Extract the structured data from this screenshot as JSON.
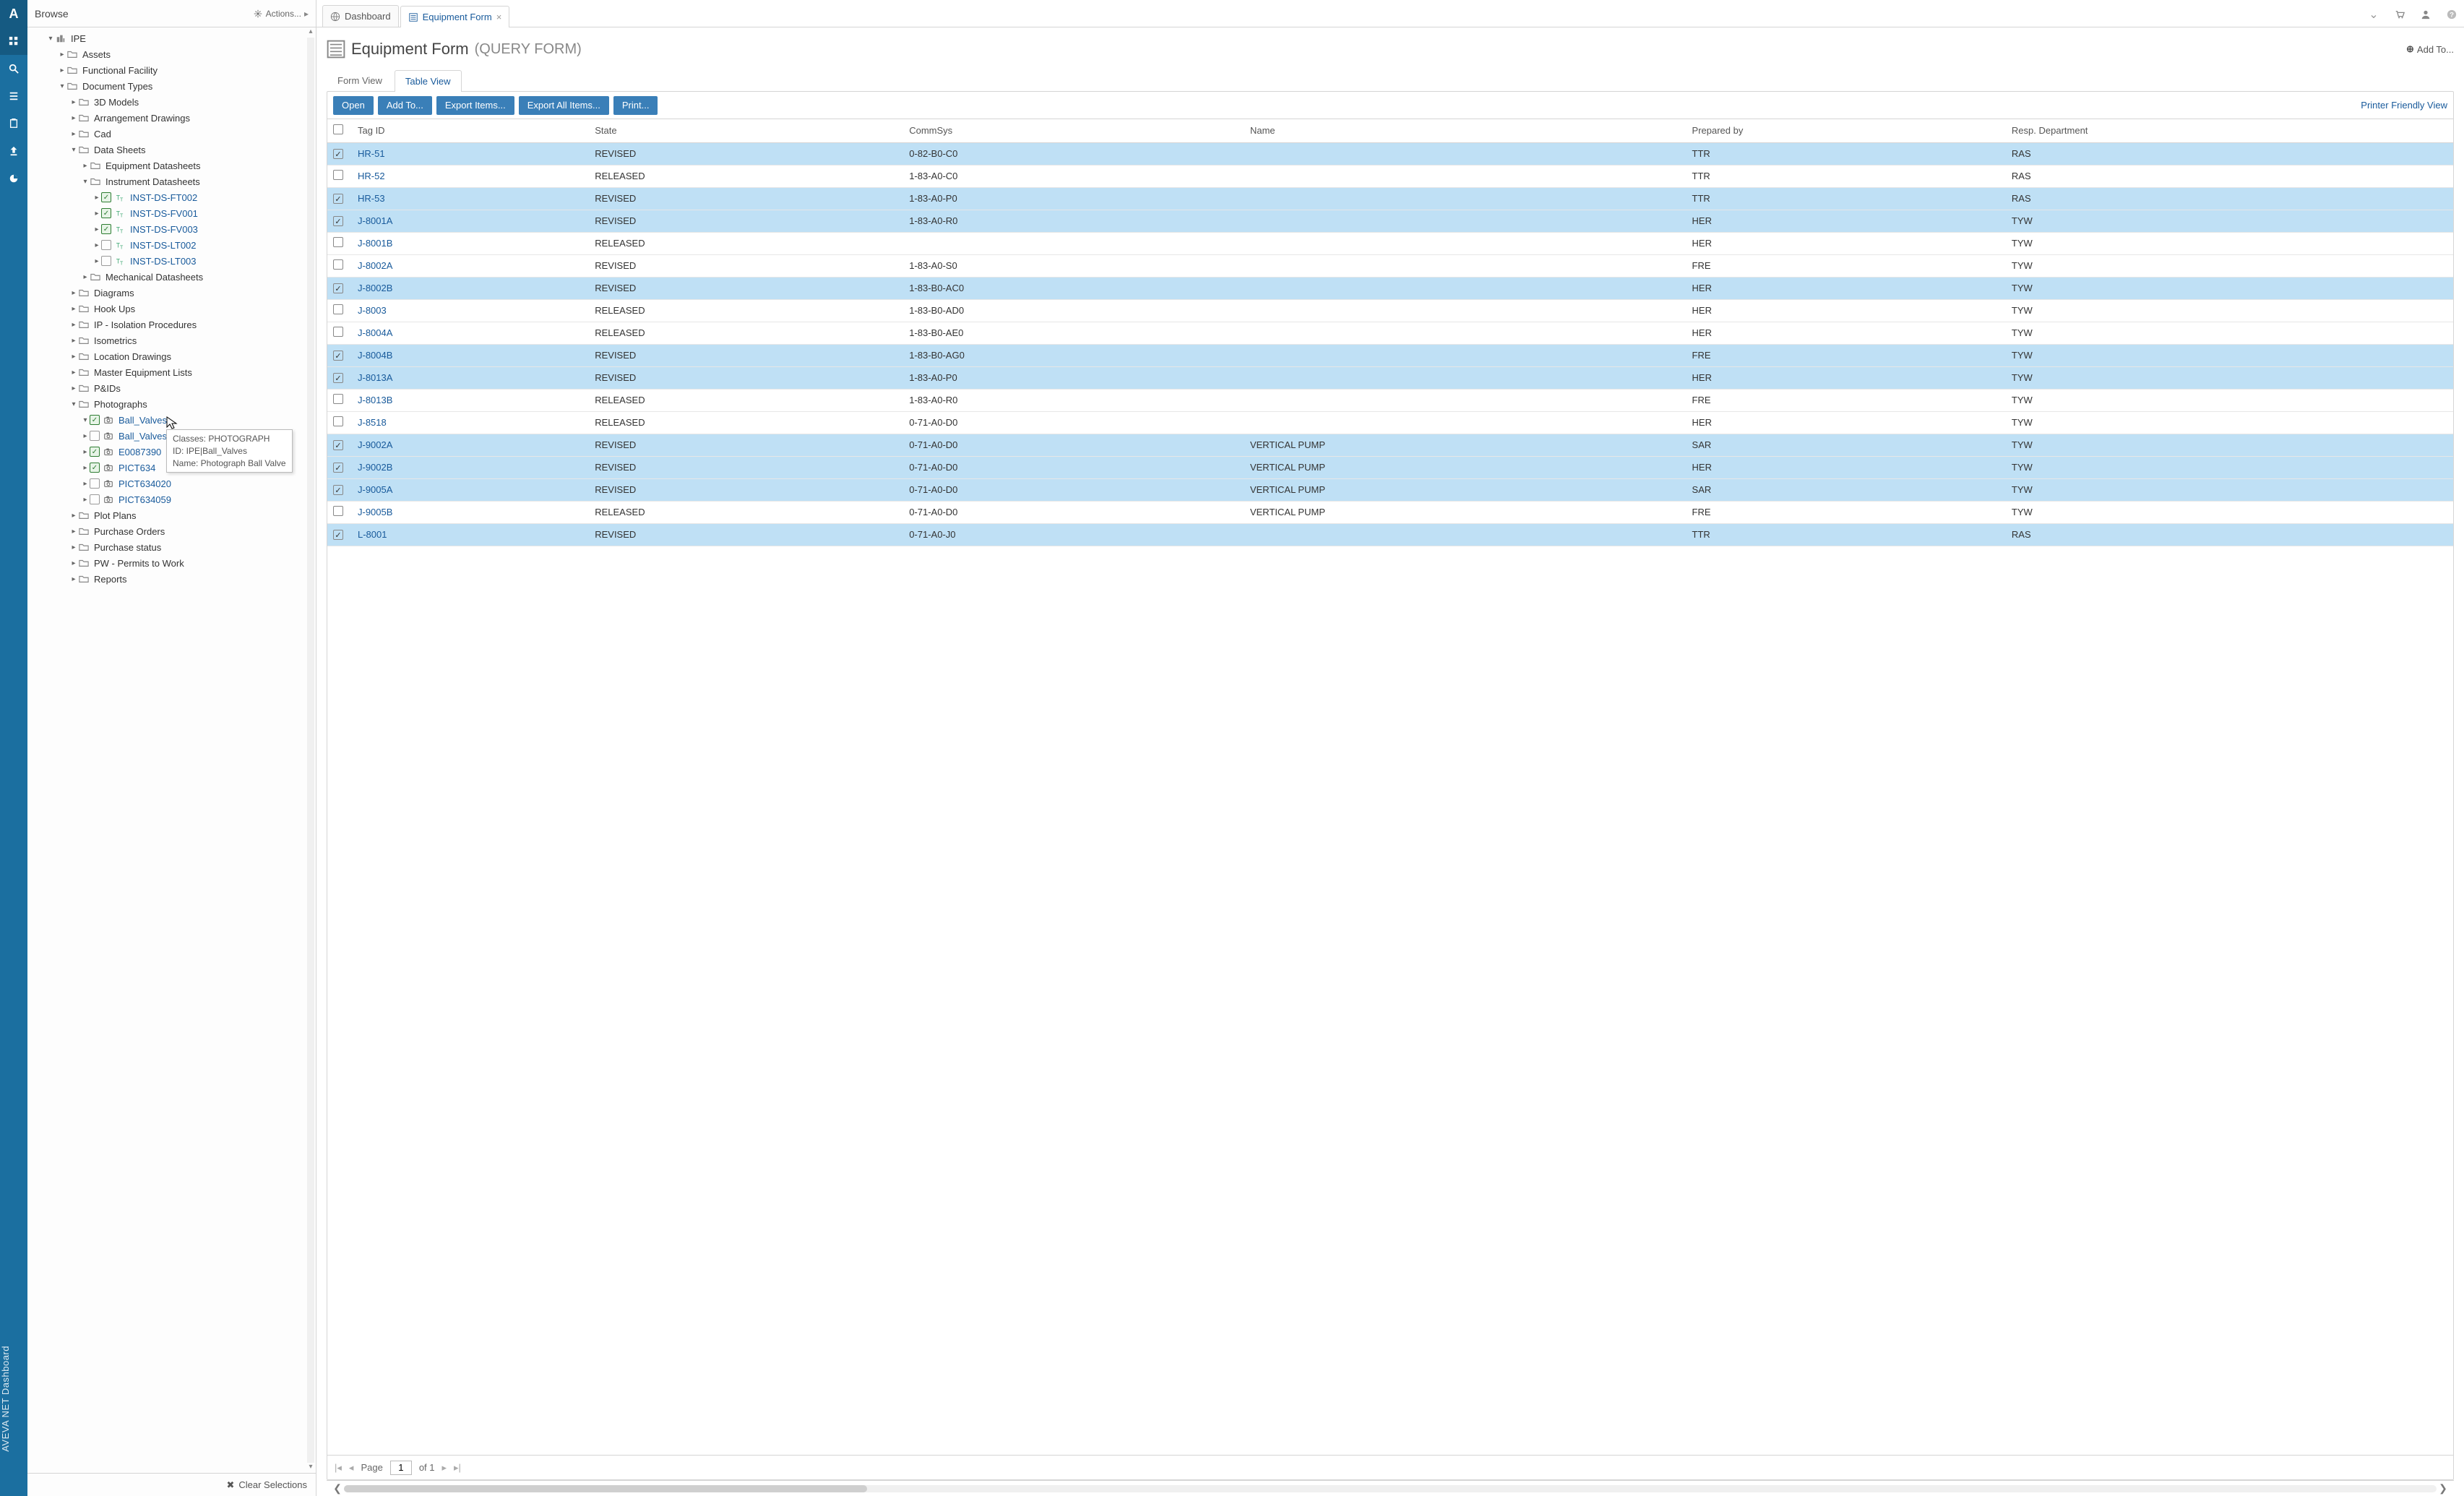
{
  "rail_brand": "AVEVA NET Dashboard",
  "browse": {
    "title": "Browse",
    "actions_label": "Actions...",
    "clear_label": "Clear Selections",
    "root_label": "IPE",
    "tooltip": {
      "l1": "Classes: PHOTOGRAPH",
      "l2": "ID: IPE|Ball_Valves",
      "l3": "Name: Photograph Ball Valve"
    },
    "nodes": [
      {
        "d": 1,
        "tw": "▾",
        "ico": "site",
        "label": "IPE"
      },
      {
        "d": 2,
        "tw": "▸",
        "ico": "fld",
        "label": "Assets"
      },
      {
        "d": 2,
        "tw": "▸",
        "ico": "fld",
        "label": "Functional Facility"
      },
      {
        "d": 2,
        "tw": "▾",
        "ico": "fld",
        "label": "Document Types"
      },
      {
        "d": 3,
        "tw": "▸",
        "ico": "fld",
        "label": "3D Models"
      },
      {
        "d": 3,
        "tw": "▸",
        "ico": "fld",
        "label": "Arrangement Drawings"
      },
      {
        "d": 3,
        "tw": "▸",
        "ico": "fld",
        "label": "Cad"
      },
      {
        "d": 3,
        "tw": "▾",
        "ico": "fld",
        "label": "Data Sheets"
      },
      {
        "d": 4,
        "tw": "▸",
        "ico": "fld",
        "label": "Equipment Datasheets"
      },
      {
        "d": 4,
        "tw": "▾",
        "ico": "fld",
        "label": "Instrument Datasheets"
      },
      {
        "d": 5,
        "tw": "▸",
        "chk": true,
        "ico": "tt",
        "label": "INST-DS-FT002",
        "link": true
      },
      {
        "d": 5,
        "tw": "▸",
        "chk": true,
        "ico": "tt",
        "label": "INST-DS-FV001",
        "link": true
      },
      {
        "d": 5,
        "tw": "▸",
        "chk": true,
        "ico": "tt",
        "label": "INST-DS-FV003",
        "link": true
      },
      {
        "d": 5,
        "tw": "▸",
        "chk": false,
        "ico": "tt",
        "label": "INST-DS-LT002",
        "link": true
      },
      {
        "d": 5,
        "tw": "▸",
        "chk": false,
        "ico": "tt",
        "label": "INST-DS-LT003",
        "link": true
      },
      {
        "d": 4,
        "tw": "▸",
        "ico": "fld",
        "label": "Mechanical Datasheets"
      },
      {
        "d": 3,
        "tw": "▸",
        "ico": "fld",
        "label": "Diagrams"
      },
      {
        "d": 3,
        "tw": "▸",
        "ico": "fld",
        "label": "Hook Ups"
      },
      {
        "d": 3,
        "tw": "▸",
        "ico": "fld",
        "label": "IP - Isolation Procedures"
      },
      {
        "d": 3,
        "tw": "▸",
        "ico": "fld",
        "label": "Isometrics"
      },
      {
        "d": 3,
        "tw": "▸",
        "ico": "fld",
        "label": "Location Drawings"
      },
      {
        "d": 3,
        "tw": "▸",
        "ico": "fld",
        "label": "Master Equipment Lists"
      },
      {
        "d": 3,
        "tw": "▸",
        "ico": "fld",
        "label": "P&IDs"
      },
      {
        "d": 3,
        "tw": "▾",
        "ico": "fld",
        "label": "Photographs"
      },
      {
        "d": 4,
        "tw": "▾",
        "chk": true,
        "ico": "cam",
        "label": "Ball_Valves",
        "link": true,
        "hot": true
      },
      {
        "d": 4,
        "tw": "▸",
        "chk": false,
        "ico": "cam",
        "label": "Ball_Valves",
        "link": true
      },
      {
        "d": 4,
        "tw": "▸",
        "chk": true,
        "ico": "cam",
        "label": "E0087390",
        "link": true
      },
      {
        "d": 4,
        "tw": "▸",
        "chk": true,
        "ico": "cam",
        "label": "PICT634",
        "link": true
      },
      {
        "d": 4,
        "tw": "▸",
        "chk": false,
        "ico": "cam",
        "label": "PICT634020",
        "link": true
      },
      {
        "d": 4,
        "tw": "▸",
        "chk": false,
        "ico": "cam",
        "label": "PICT634059",
        "link": true
      },
      {
        "d": 3,
        "tw": "▸",
        "ico": "fld",
        "label": "Plot Plans"
      },
      {
        "d": 3,
        "tw": "▸",
        "ico": "fld",
        "label": "Purchase Orders"
      },
      {
        "d": 3,
        "tw": "▸",
        "ico": "fld",
        "label": "Purchase status"
      },
      {
        "d": 3,
        "tw": "▸",
        "ico": "fld",
        "label": "PW - Permits to Work"
      },
      {
        "d": 3,
        "tw": "▸",
        "ico": "fld",
        "label": "Reports"
      }
    ]
  },
  "tabs": {
    "dashboard": "Dashboard",
    "equipment": "Equipment Form"
  },
  "page": {
    "title": "Equipment Form",
    "subtitle": "(QUERY FORM)",
    "add_to": "Add To..."
  },
  "viewtabs": {
    "form": "Form View",
    "table": "Table View"
  },
  "toolbar": {
    "open": "Open",
    "addto": "Add To...",
    "export": "Export Items...",
    "exportall": "Export All Items...",
    "print": "Print...",
    "pfv": "Printer Friendly View"
  },
  "grid": {
    "headers": [
      "Tag ID",
      "State",
      "CommSys",
      "Name",
      "Prepared by",
      "Resp. Department"
    ],
    "rows": [
      {
        "sel": true,
        "id": "HR-51",
        "state": "REVISED",
        "comm": "0-82-B0-C0",
        "name": "",
        "prep": "TTR",
        "dept": "RAS"
      },
      {
        "sel": false,
        "id": "HR-52",
        "state": "RELEASED",
        "comm": "1-83-A0-C0",
        "name": "",
        "prep": "TTR",
        "dept": "RAS"
      },
      {
        "sel": true,
        "id": "HR-53",
        "state": "REVISED",
        "comm": "1-83-A0-P0",
        "name": "",
        "prep": "TTR",
        "dept": "RAS"
      },
      {
        "sel": true,
        "id": "J-8001A",
        "state": "REVISED",
        "comm": "1-83-A0-R0",
        "name": "",
        "prep": "HER",
        "dept": "TYW"
      },
      {
        "sel": false,
        "id": "J-8001B",
        "state": "RELEASED",
        "comm": "",
        "name": "",
        "prep": "HER",
        "dept": "TYW"
      },
      {
        "sel": false,
        "id": "J-8002A",
        "state": "REVISED",
        "comm": "1-83-A0-S0",
        "name": "",
        "prep": "FRE",
        "dept": "TYW"
      },
      {
        "sel": true,
        "id": "J-8002B",
        "state": "REVISED",
        "comm": "1-83-B0-AC0",
        "name": "",
        "prep": "HER",
        "dept": "TYW"
      },
      {
        "sel": false,
        "id": "J-8003",
        "state": "RELEASED",
        "comm": "1-83-B0-AD0",
        "name": "",
        "prep": "HER",
        "dept": "TYW"
      },
      {
        "sel": false,
        "id": "J-8004A",
        "state": "RELEASED",
        "comm": "1-83-B0-AE0",
        "name": "",
        "prep": "HER",
        "dept": "TYW"
      },
      {
        "sel": true,
        "id": "J-8004B",
        "state": "REVISED",
        "comm": "1-83-B0-AG0",
        "name": "",
        "prep": "FRE",
        "dept": "TYW"
      },
      {
        "sel": true,
        "id": "J-8013A",
        "state": "REVISED",
        "comm": "1-83-A0-P0",
        "name": "",
        "prep": "HER",
        "dept": "TYW"
      },
      {
        "sel": false,
        "id": "J-8013B",
        "state": "RELEASED",
        "comm": "1-83-A0-R0",
        "name": "",
        "prep": "FRE",
        "dept": "TYW"
      },
      {
        "sel": false,
        "id": "J-8518",
        "state": "RELEASED",
        "comm": "0-71-A0-D0",
        "name": "",
        "prep": "HER",
        "dept": "TYW"
      },
      {
        "sel": true,
        "id": "J-9002A",
        "state": "REVISED",
        "comm": "0-71-A0-D0",
        "name": "VERTICAL PUMP",
        "prep": "SAR",
        "dept": "TYW"
      },
      {
        "sel": true,
        "id": "J-9002B",
        "state": "REVISED",
        "comm": "0-71-A0-D0",
        "name": "VERTICAL PUMP",
        "prep": "HER",
        "dept": "TYW"
      },
      {
        "sel": true,
        "id": "J-9005A",
        "state": "REVISED",
        "comm": "0-71-A0-D0",
        "name": "VERTICAL PUMP",
        "prep": "SAR",
        "dept": "TYW"
      },
      {
        "sel": false,
        "id": "J-9005B",
        "state": "RELEASED",
        "comm": "0-71-A0-D0",
        "name": "VERTICAL PUMP",
        "prep": "FRE",
        "dept": "TYW"
      },
      {
        "sel": true,
        "id": "L-8001",
        "state": "REVISED",
        "comm": "0-71-A0-J0",
        "name": "",
        "prep": "TTR",
        "dept": "RAS"
      }
    ]
  },
  "pager": {
    "page_label": "Page",
    "page": "1",
    "of": "of 1"
  }
}
